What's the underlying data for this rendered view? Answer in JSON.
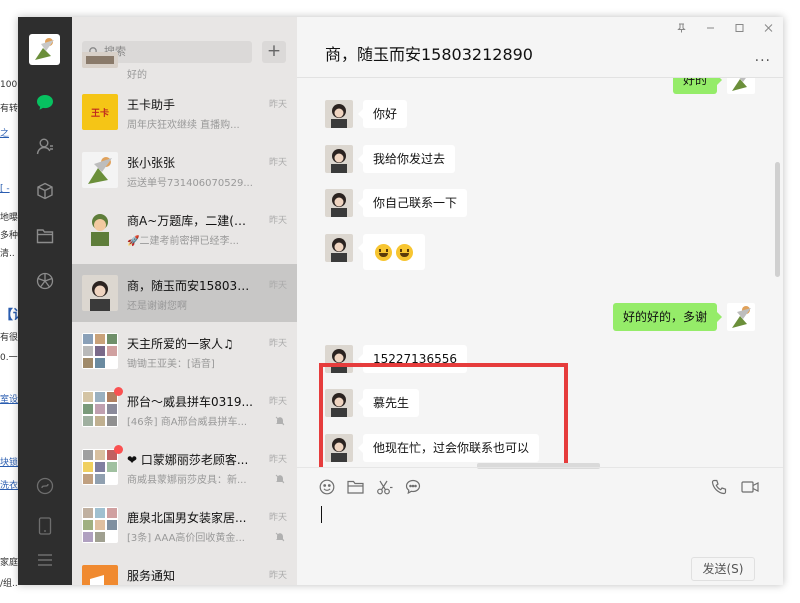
{
  "background_page": {
    "fragments": [
      "100·",
      "有转",
      "之",
      "[ - ",
      "地曝",
      "多种",
      "清..",
      "【详",
      "有很",
      "0.一",
      "室设",
      "块锁",
      "洗衣",
      "家庭",
      "/组.."
    ]
  },
  "nav": {
    "icons": [
      "chat-icon",
      "contacts-icon",
      "favorites-icon",
      "files-icon",
      "moments-icon",
      "mini-program-icon",
      "phone-icon",
      "menu-icon"
    ]
  },
  "search": {
    "placeholder": "搜索",
    "add_label": "+"
  },
  "conversations": [
    {
      "name": "",
      "preview": "好的",
      "time": "",
      "active": false
    },
    {
      "name": "王卡助手",
      "preview": "周年庆狂欢继续  直播购...",
      "time": "昨天",
      "active": false
    },
    {
      "name": "张小张张",
      "preview": "运送单号731406070529...",
      "time": "昨天",
      "active": false
    },
    {
      "name": "商A~万题库，二建(刘...",
      "preview": "🚀二建考前密押已经李...",
      "time": "昨天",
      "active": false
    },
    {
      "name": "商，随玉而安158032...",
      "preview": "还是谢谢您啊",
      "time": "昨天",
      "active": true
    },
    {
      "name": "天主所爱的一家人♫",
      "preview": "锄锄王亚美：[语音]",
      "time": "昨天",
      "active": false
    },
    {
      "name": "邢台～威县拼车0319...",
      "preview": "[46条] 商A邢台威县拼车...",
      "time": "昨天",
      "active": false
    },
    {
      "name": "❤ 口蒙娜丽莎老顾客...",
      "preview": "商威县蒙娜丽莎皮具：新...",
      "time": "昨天",
      "active": false
    },
    {
      "name": "鹿泉北国男女装家居...",
      "preview": "[3条] AAA高价回收黄金...",
      "time": "昨天",
      "active": false
    },
    {
      "name": "服务通知",
      "preview": "",
      "time": "昨天",
      "active": false
    }
  ],
  "chat": {
    "title": "商，随玉而安15803212890",
    "window_controls": [
      "pin-icon",
      "minimize-icon",
      "maximize-icon",
      "close-icon"
    ],
    "more_label": "...",
    "messages": [
      {
        "dir": "out",
        "text": "好的"
      },
      {
        "dir": "in",
        "text": "你好"
      },
      {
        "dir": "in",
        "text": "我给你发过去"
      },
      {
        "dir": "in",
        "text": "你自己联系一下"
      },
      {
        "dir": "in",
        "text": "[emoji][emoji]"
      },
      {
        "dir": "out",
        "text": "好的好的，多谢"
      },
      {
        "dir": "in",
        "text": "15227136556"
      },
      {
        "dir": "in",
        "text": "慕先生"
      },
      {
        "dir": "in",
        "text": "他现在忙，过会你联系也可以"
      }
    ],
    "highlight_color": "#e63c3c",
    "send_label": "发送(S)"
  },
  "colors": {
    "nav_bg": "#2e2e2e",
    "list_bg": "#e8e6e5",
    "active_conv": "#c8c7c6",
    "chat_bg": "#f5f5f5",
    "out_bubble": "#95ec69",
    "accent": "#07c160"
  }
}
